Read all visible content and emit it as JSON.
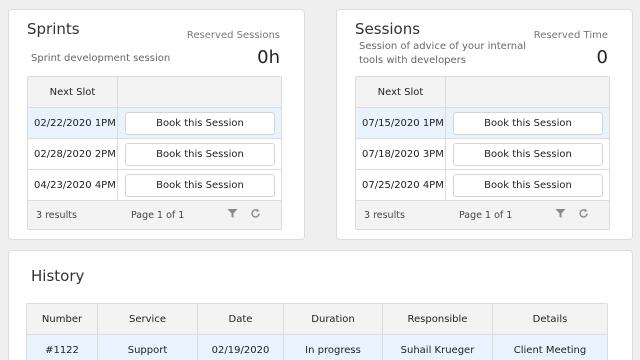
{
  "sprints": {
    "title": "Sprints",
    "description": "Sprint development session",
    "reserved_label": "Reserved Sessions",
    "reserved_value": "0h",
    "column_header": "Next Slot",
    "rows": [
      {
        "slot": "02/22/2020 1PM",
        "button": "Book this Session"
      },
      {
        "slot": "02/28/2020 2PM",
        "button": "Book this Session"
      },
      {
        "slot": "04/23/2020 4PM",
        "button": "Book this Session"
      }
    ],
    "results": "3 results",
    "page": "Page 1 of 1"
  },
  "sessions": {
    "title": "Sessions",
    "description_line1": "Session of advice of your internal",
    "description_line2": "tools with developers",
    "reserved_label": "Reserved Time",
    "reserved_value": "0",
    "column_header": "Next Slot",
    "rows": [
      {
        "slot": "07/15/2020 1PM",
        "button": "Book this Session"
      },
      {
        "slot": "07/18/2020 3PM",
        "button": "Book this Session"
      },
      {
        "slot": "07/25/2020 4PM",
        "button": "Book this Session"
      }
    ],
    "results": "3 results",
    "page": "Page 1 of 1"
  },
  "history": {
    "title": "History",
    "columns": [
      "Number",
      "Service",
      "Date",
      "Duration",
      "Responsible",
      "Details"
    ],
    "rows": [
      [
        "#1122",
        "Support",
        "02/19/2020",
        "In progress",
        "Suhail Krueger",
        "Client Meeting"
      ]
    ]
  },
  "icons": {
    "filter": "filter-icon",
    "refresh": "refresh-icon"
  },
  "colors": {
    "selected_row": "#e9f3fd",
    "header_bg": "#f3f3f3",
    "page_bg": "#efefef"
  }
}
